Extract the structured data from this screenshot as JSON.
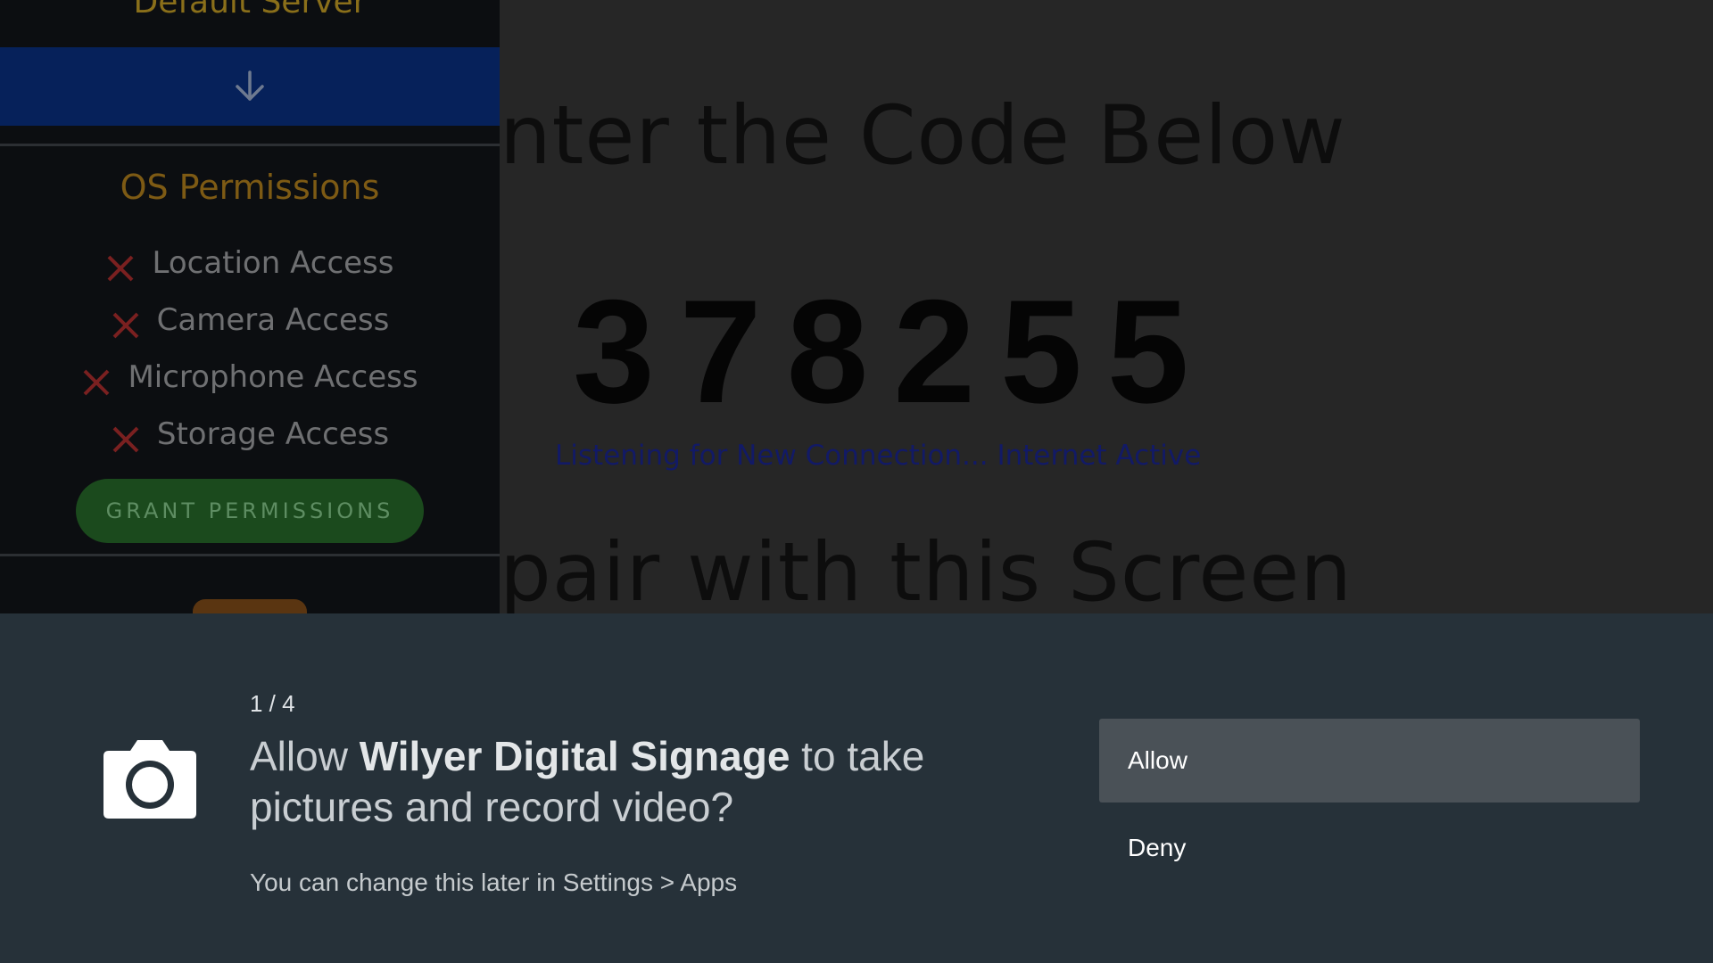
{
  "main": {
    "heading_top": "nter the Code Below",
    "pair_code": "378255",
    "status_line": "Listening for New Connection... Internet Active",
    "heading_bottom": "pair with this Screen"
  },
  "sidebar": {
    "title": "Default Server",
    "toggle_icon": "arrow-down-icon",
    "permissions_title": "OS Permissions",
    "permissions": [
      {
        "label": "Location Access",
        "icon": "x-icon",
        "granted": false
      },
      {
        "label": "Camera Access",
        "icon": "x-icon",
        "granted": false
      },
      {
        "label": "Microphone Access",
        "icon": "x-icon",
        "granted": false
      },
      {
        "label": "Storage Access",
        "icon": "x-icon",
        "granted": false
      }
    ],
    "grant_button_label": "GRANT PERMISSIONS"
  },
  "dialog": {
    "icon": "camera-icon",
    "counter": "1 / 4",
    "message_prefix": "Allow ",
    "app_name": "Wilyer Digital Signage",
    "message_suffix": " to take pictures and record video?",
    "note": "You can change this later in Settings > Apps",
    "allow_label": "Allow",
    "deny_label": "Deny"
  },
  "colors": {
    "dialog_background": "#263139",
    "sidebar_background": "#0c0e11",
    "toggle_background": "#06215a",
    "grant_button": "#1b4a1d",
    "denied_x": "#7a2020",
    "permissions_title": "#7d5a14"
  }
}
